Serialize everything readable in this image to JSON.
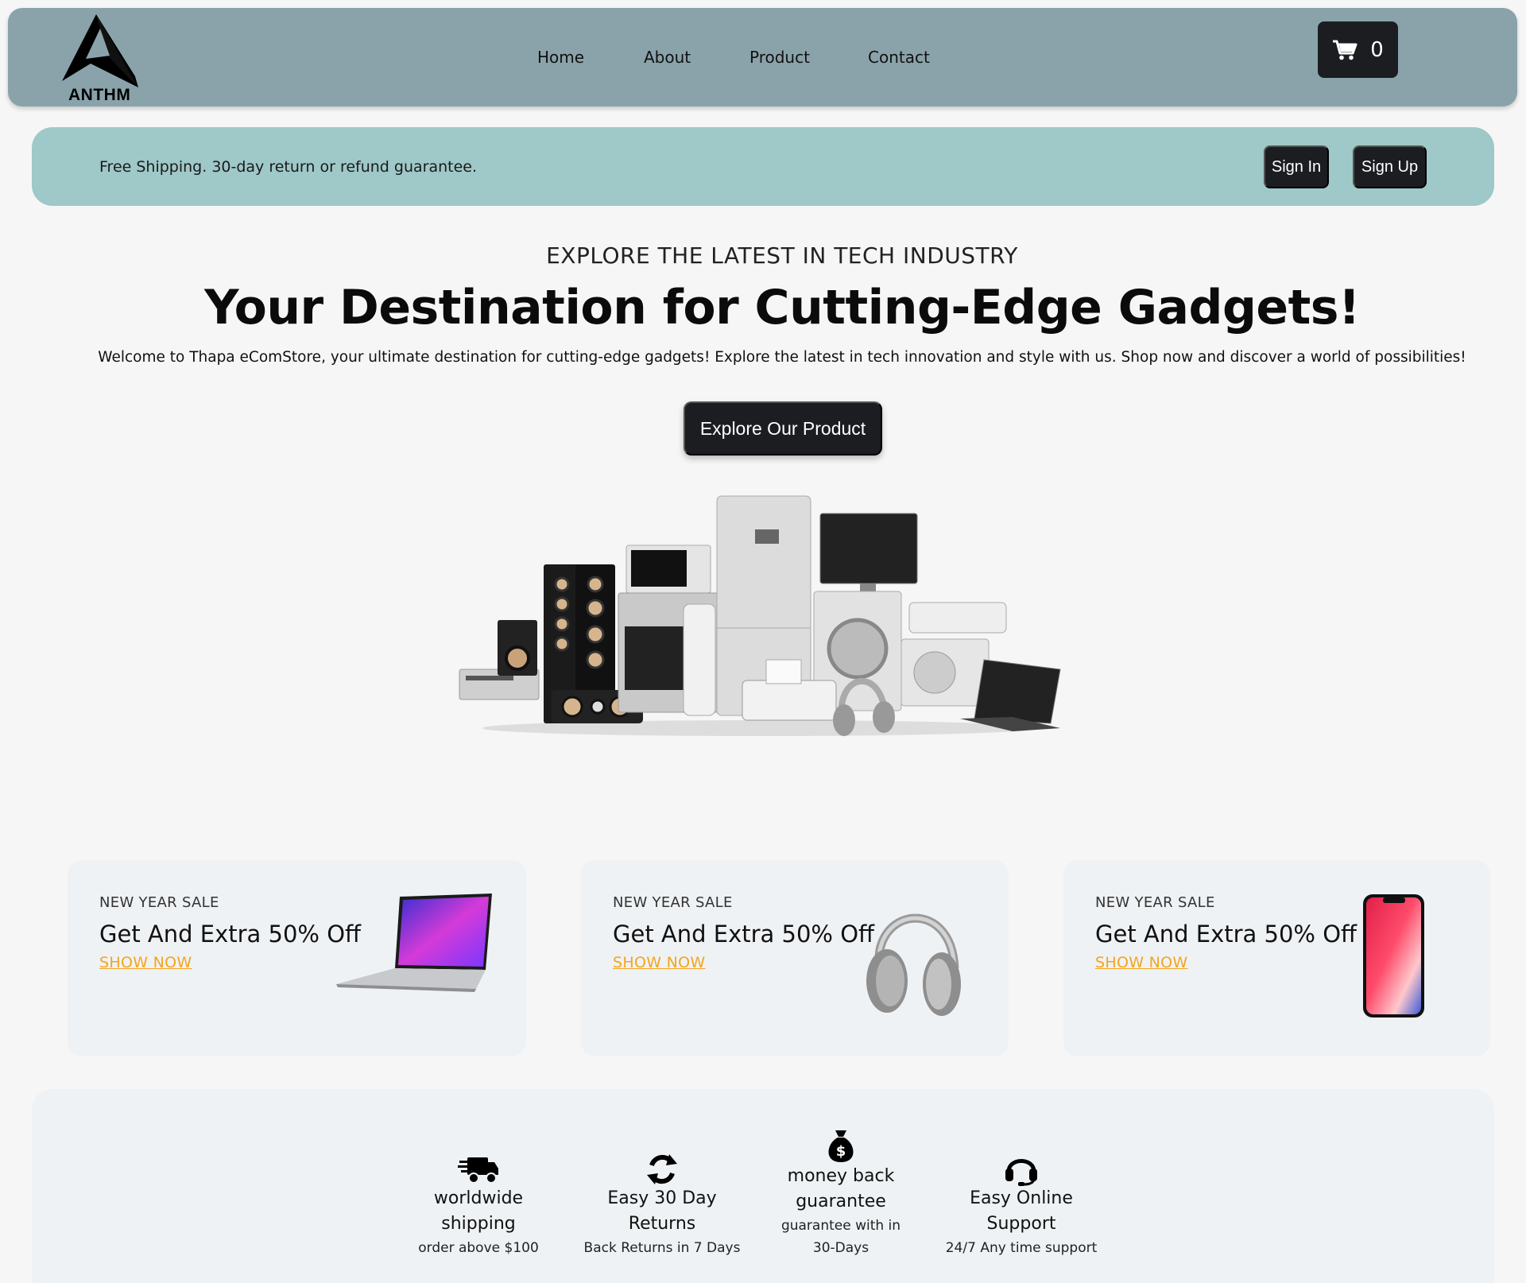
{
  "header": {
    "logo_text": "ANTHM",
    "nav": [
      "Home",
      "About",
      "Product",
      "Contact"
    ],
    "cart_count": "0",
    "cart_icon": "cart-icon"
  },
  "promo": {
    "text": "Free Shipping. 30-day return or refund guarantee.",
    "sign_in": "Sign In",
    "sign_up": "Sign Up"
  },
  "hero": {
    "eyebrow": "EXPLORE THE LATEST IN TECH INDUSTRY",
    "title": "Your Destination for Cutting-Edge Gadgets!",
    "description": "Welcome to Thapa eComStore, your ultimate destination for cutting-edge gadgets! Explore the latest in tech innovation and style with us. Shop now and discover a world of possibilities!",
    "cta": "Explore Our Product"
  },
  "cards": [
    {
      "kicker": "NEW YEAR SALE",
      "title": "Get And Extra 50% Off",
      "link": "SHOW NOW",
      "image": "laptop"
    },
    {
      "kicker": "NEW YEAR SALE",
      "title": "Get And Extra 50% Off",
      "link": "SHOW NOW",
      "image": "headphones"
    },
    {
      "kicker": "NEW YEAR SALE",
      "title": "Get And Extra 50% Off",
      "link": "SHOW NOW",
      "image": "smartphone"
    }
  ],
  "features": [
    {
      "icon": "truck-icon",
      "title": "worldwide shipping",
      "subtitle": "order above $100"
    },
    {
      "icon": "refresh-icon",
      "title": "Easy 30 Day Returns",
      "subtitle": "Back Returns in 7 Days"
    },
    {
      "icon": "money-bag-icon",
      "title": "money back guarantee",
      "subtitle": "guarantee with in 30-Days"
    },
    {
      "icon": "headset-icon",
      "title": "Easy Online Support",
      "subtitle": "24/7 Any time support"
    }
  ],
  "colors": {
    "header_bg": "#8aa3aa",
    "promo_bg": "#9fc8c8",
    "button_dark": "#1b1d21",
    "accent_link": "#f3a51d",
    "card_bg": "#eff2f4"
  }
}
